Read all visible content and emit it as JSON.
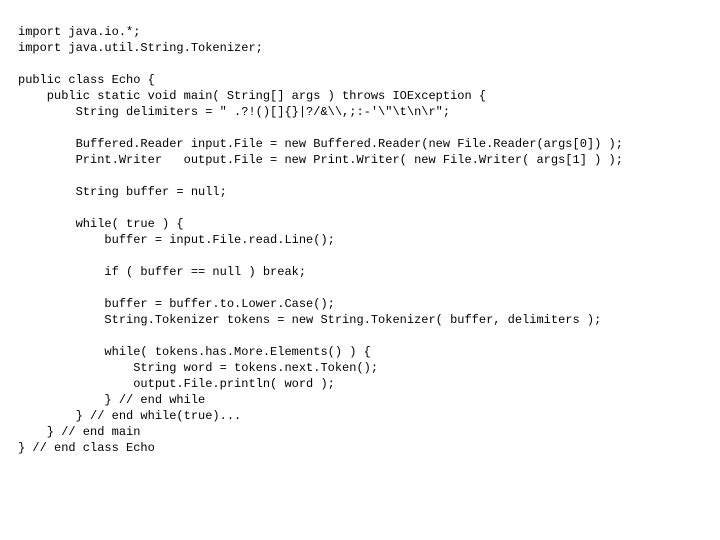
{
  "code": {
    "lines": [
      "import java.io.*;",
      "import java.util.String.Tokenizer;",
      "",
      "public class Echo {",
      "    public static void main( String[] args ) throws IOException {",
      "        String delimiters = \" .?!()[]{}|?/&\\\\,;:-'\\\"\\t\\n\\r\";",
      "",
      "        Buffered.Reader input.File = new Buffered.Reader(new File.Reader(args[0]) );",
      "        Print.Writer   output.File = new Print.Writer( new File.Writer( args[1] ) );",
      "",
      "        String buffer = null;",
      "",
      "        while( true ) {",
      "            buffer = input.File.read.Line();",
      "",
      "            if ( buffer == null ) break;",
      "",
      "            buffer = buffer.to.Lower.Case();",
      "            String.Tokenizer tokens = new String.Tokenizer( buffer, delimiters );",
      "",
      "            while( tokens.has.More.Elements() ) {",
      "                String word = tokens.next.Token();",
      "                output.File.println( word );",
      "            } // end while",
      "        } // end while(true)...",
      "    } // end main",
      "} // end class Echo"
    ]
  }
}
